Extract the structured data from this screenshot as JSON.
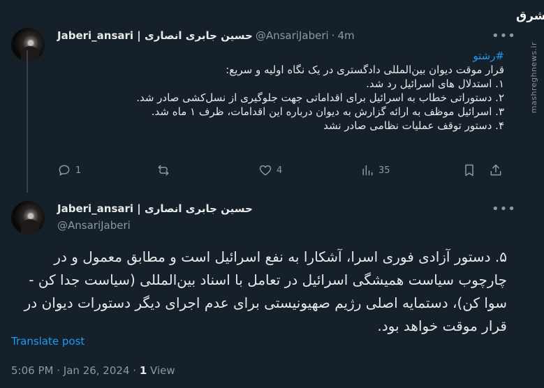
{
  "watermark": {
    "logo_text": "مشرق",
    "site": "mashreghnews.ir"
  },
  "tweet1": {
    "display_name": "Jaberi_ansari | حسین جابری انصاری",
    "handle": "@AnsariJaberi",
    "dot": "·",
    "time": "4m",
    "hashtag": "#رشتو",
    "lines": [
      "قرار موقت دیوان بین‌المللی دادگستری در یک نگاه اولیه و سریع:",
      "۱. استدلال های اسرائیل رد شد.",
      "۲. دستوراتی خطاب به اسرائیل برای اقداماتی جهت جلوگیری از نسل‌کشی صادر شد.",
      "۳. اسرائیل موظف به ارائه گزارش به دیوان درباره این اقدامات، ظرف ۱ ماه شد.",
      "۴. دستور توقف عملیات نظامی صادر نشد"
    ],
    "actions": {
      "replies": "1",
      "retweets": "",
      "likes": "4",
      "views": "35"
    }
  },
  "tweet2": {
    "display_name": "Jaberi_ansari | حسین جابری انصاری",
    "handle": "@AnsariJaberi",
    "body": "۵. دستور آزادی فوری اسرا، آشکارا به نفع اسرائیل است و مطابق معمول و در چارچوب سیاست همیشگی اسرائیل در تعامل با اسناد بین‌المللی (سیاست جدا کن - سوا کن)، دستمایه اصلی رژیم صهیونیستی برای عدم اجرای دیگر دستورات دیوان در قرار موقت خواهد بود.",
    "translate": "Translate post",
    "time": "5:06 PM",
    "date": "Jan 26, 2024",
    "views_count": "1",
    "views_label": "View",
    "sep": "·"
  },
  "icons": {
    "reply": "reply-icon",
    "retweet": "retweet-icon",
    "like": "heart-icon",
    "views": "views-icon",
    "bookmark": "bookmark-icon",
    "share": "share-icon",
    "more": "more-icon"
  },
  "colors": {
    "background": "#15202b",
    "text": "#e7e9ea",
    "secondary": "#8b98a5",
    "accent": "#1d9bf0"
  }
}
